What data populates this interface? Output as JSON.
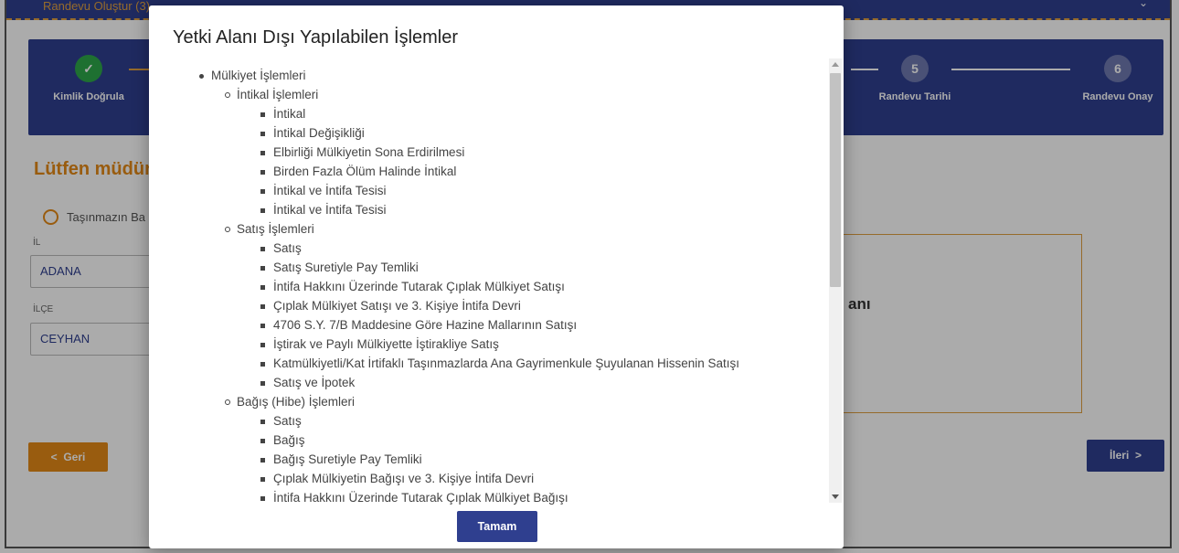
{
  "topbar": {
    "label": "Randevu Oluştur (3)"
  },
  "stepper": {
    "steps": [
      {
        "num": "✓",
        "label": "Kimlik Doğrula"
      },
      {
        "num": "5",
        "label": "Randevu Tarihi"
      },
      {
        "num": "6",
        "label": "Randevu Onay"
      }
    ]
  },
  "main": {
    "prompt": "Lütfen müdür",
    "radio_label": "Taşınmazın Ba",
    "il_label": "İL",
    "il_value": "ADANA",
    "ilce_label": "İLÇE",
    "ilce_value": "CEYHAN",
    "box_text": "anı",
    "back_label": "Geri",
    "next_label": "İleri"
  },
  "colors": {
    "primary": "#2f3f8f",
    "accent": "#e58a17",
    "success": "#2ea84a"
  },
  "modal": {
    "title": "Yetki Alanı Dışı Yapılabilen İşlemler",
    "button_label": "Tamam",
    "list": {
      "top": "Mülkiyet İşlemleri",
      "groups": [
        {
          "title": "İntikal İşlemleri",
          "items": [
            "İntikal",
            "İntikal Değişikliği",
            "Elbirliği Mülkiyetin Sona Erdirilmesi",
            "Birden Fazla Ölüm Halinde İntikal",
            "İntikal ve İntifa Tesisi",
            "İntikal ve İntifa Tesisi"
          ]
        },
        {
          "title": "Satış İşlemleri",
          "items": [
            "Satış",
            "Satış Suretiyle Pay Temliki",
            "İntifa Hakkını Üzerinde Tutarak Çıplak Mülkiyet Satışı",
            "Çıplak Mülkiyet Satışı ve 3. Kişiye İntifa Devri",
            "4706 S.Y. 7/B Maddesine Göre Hazine Mallarının Satışı",
            "İştirak ve Paylı Mülkiyette İştirakliye Satış",
            "Katmülkiyetli/Kat İrtifaklı Taşınmazlarda Ana Gayrimenkule Şuyulanan Hissenin Satışı",
            "Satış ve İpotek"
          ]
        },
        {
          "title": "Bağış (Hibe) İşlemleri",
          "items": [
            "Satış",
            "Bağış",
            "Bağış Suretiyle Pay Temliki",
            "Çıplak Mülkiyetin Bağışı ve 3. Kişiye İntifa Devri",
            "İntifa Hakkını Üzerinde Tutarak Çıplak Mülkiyet Bağışı"
          ]
        }
      ]
    }
  }
}
